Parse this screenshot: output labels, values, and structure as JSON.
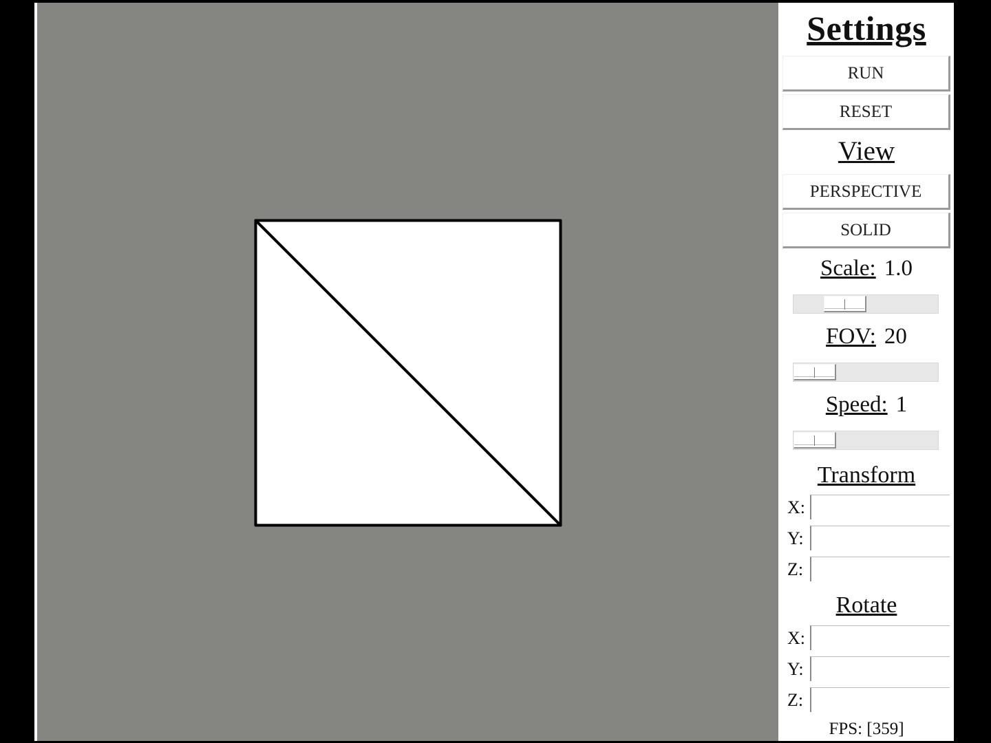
{
  "viewport": {
    "background_color": "#858581",
    "shape": {
      "type": "square split by diagonal",
      "fill_color": "#ffffff",
      "stroke_color": "#000000"
    }
  },
  "panel": {
    "title": "Settings",
    "run_label": "RUN",
    "reset_label": "RESET",
    "view_title": "View",
    "perspective_label": "PERSPECTIVE",
    "solid_label": "SOLID",
    "scale": {
      "label": "Scale:",
      "value": "1.0",
      "slider_position": 0.3
    },
    "fov": {
      "label": "FOV:",
      "value": "20",
      "slider_position": 0.0
    },
    "speed": {
      "label": "Speed:",
      "value": "1",
      "slider_position": 0.0
    },
    "transform_title": "Transform",
    "transform": [
      {
        "axis": "X:",
        "value": ""
      },
      {
        "axis": "Y:",
        "value": ""
      },
      {
        "axis": "Z:",
        "value": ""
      }
    ],
    "rotate_title": "Rotate",
    "rotate": [
      {
        "axis": "X:",
        "value": ""
      },
      {
        "axis": "Y:",
        "value": ""
      },
      {
        "axis": "Z:",
        "value": ""
      }
    ],
    "fps_text": "FPS: [359]"
  }
}
